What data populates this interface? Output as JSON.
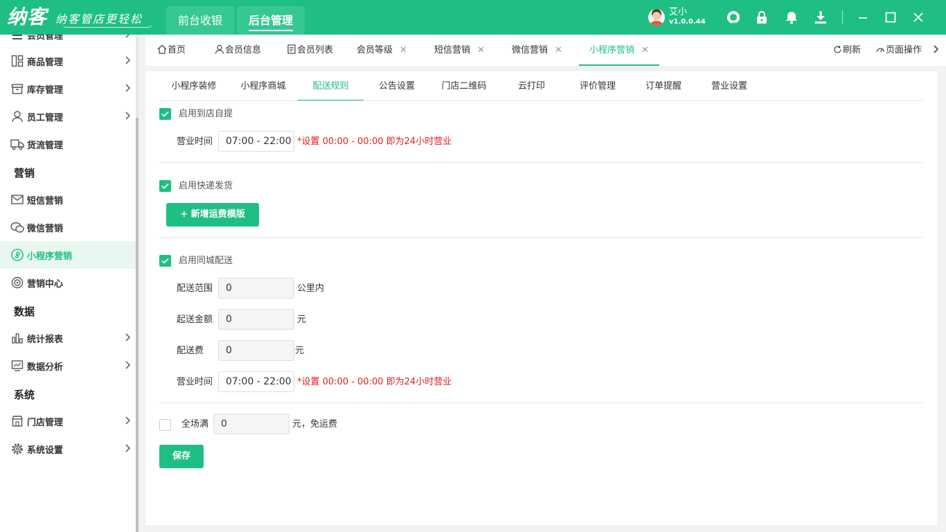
{
  "brand": {
    "name": "纳客",
    "slogan": "纳客管店更轻松"
  },
  "top_tabs": [
    {
      "label": "前台收银"
    },
    {
      "label": "后台管理"
    }
  ],
  "user": {
    "name": "艾小",
    "version": "v1.0.0.44"
  },
  "colors": {
    "primary": "#1fbf83",
    "hint": "#e02020"
  },
  "icons": [
    "headset-icon",
    "lock-icon",
    "bell-icon",
    "download-icon",
    "minimize-icon",
    "maximize-icon",
    "close-icon"
  ],
  "sidebar": {
    "top_cut": "会员管理",
    "items": [
      {
        "label": "商品管理"
      },
      {
        "label": "库存管理"
      },
      {
        "label": "员工管理"
      },
      {
        "label": "货流管理"
      },
      {
        "label": "短信营销"
      },
      {
        "label": "微信营销"
      },
      {
        "label": "小程序营销"
      },
      {
        "label": "营销中心"
      },
      {
        "label": "统计报表"
      },
      {
        "label": "数据分析"
      },
      {
        "label": "门店管理"
      },
      {
        "label": "系统设置"
      }
    ],
    "groups": {
      "marketing": "营销",
      "data": "数据",
      "system": "系统"
    }
  },
  "page_tabs": [
    {
      "label": "首页"
    },
    {
      "label": "会员信息"
    },
    {
      "label": "会员列表"
    },
    {
      "label": "会员等级"
    },
    {
      "label": "短信营销"
    },
    {
      "label": "微信营销"
    },
    {
      "label": "小程序营销"
    }
  ],
  "tab_actions": {
    "refresh": "刷新",
    "page_ops": "页面操作"
  },
  "sub_tabs": [
    "小程序装修",
    "小程序商城",
    "配送规则",
    "公告设置",
    "门店二维码",
    "云打印",
    "评价管理",
    "订单提醒",
    "营业设置"
  ],
  "form": {
    "pickup": {
      "label": "启用到店自提",
      "hours_label": "营业时间",
      "hours_value": "07:00 - 22:00",
      "hint": "*设置 00:00 - 00:00 即为24小时营业"
    },
    "express": {
      "label": "启用快递发货",
      "add_template_button": "+ 新增运费模版"
    },
    "local": {
      "label": "启用同城配送",
      "range_label": "配送范围",
      "range_value": "0",
      "range_unit": "公里内",
      "min_amount_label": "起送金额",
      "min_amount_value": "0",
      "min_amount_unit": "元",
      "fee_label": "配送费",
      "fee_value": "0",
      "fee_unit": "元",
      "hours_label": "营业时间",
      "hours_value": "07:00 - 22:00",
      "hint": "*设置 00:00 - 00:00 即为24小时营业"
    },
    "free_shipping": {
      "label": "全场满",
      "value": "0",
      "suffix": "元，免运费"
    },
    "save_button": "保存"
  }
}
